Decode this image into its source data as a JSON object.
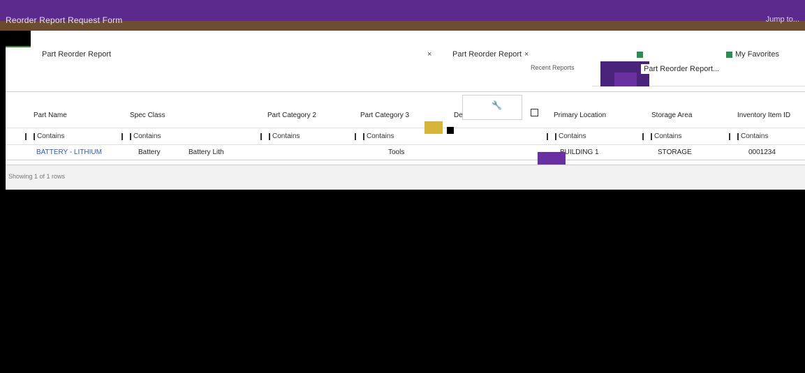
{
  "window": {
    "title": "Reorder Report Request Form",
    "right_text": "Jump to..."
  },
  "tabs": [
    {
      "label": "Part Reorder Report",
      "close": "×"
    },
    {
      "label": "Part Reorder Report",
      "close": "×"
    },
    {
      "label": "My Favorites",
      "close": ""
    }
  ],
  "toolbar": {
    "recent_label": "Recent Reports",
    "flyout_label": "Part Reorder Report..."
  },
  "grid": {
    "columns": [
      "Part Name",
      "Spec Class",
      "Part Category 2",
      "Part Category 3",
      "De",
      "Primary Location",
      "Storage Area",
      "Inventory Item ID"
    ],
    "filter_label": "Contains",
    "rows": [
      [
        "BATTERY - LITHIUM",
        "Battery",
        "Battery Lith",
        "Tools",
        "",
        "BUILDING 1",
        "STORAGE",
        "0001234"
      ]
    ]
  },
  "footer": {
    "text": "Showing 1 of 1 rows"
  },
  "colors": {
    "title_bg": "#5b2a8c",
    "accent": "#6a2fa0",
    "active_tab": "#3c8c3c"
  }
}
